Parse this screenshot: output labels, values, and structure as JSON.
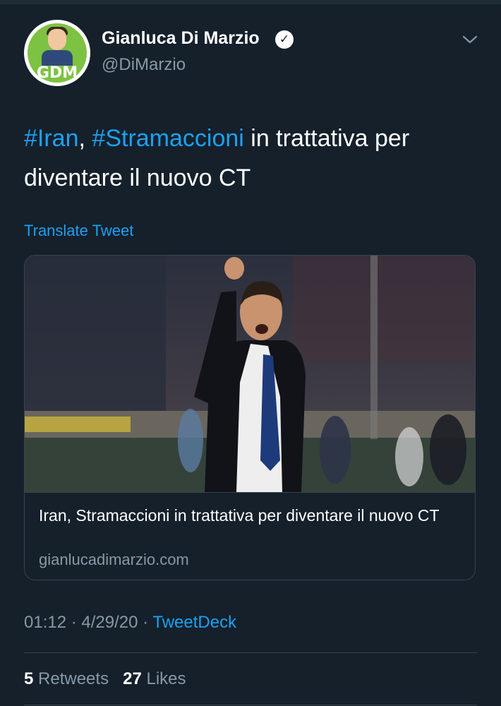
{
  "author": {
    "display_name": "Gianluca Di Marzio",
    "handle": "@DiMarzio",
    "avatar_text": "GDM",
    "verified": true
  },
  "tweet": {
    "hashtag_1": "#Iran",
    "separator": ", ",
    "hashtag_2": "#Stramaccioni",
    "text_rest": " in trattativa per diventare il nuovo CT",
    "translate_label": "Translate Tweet"
  },
  "link_card": {
    "title": "Iran, Stramaccioni in trattativa per diventare il nuovo CT",
    "domain": "gianlucadimarzio.com"
  },
  "meta": {
    "time": "01:12",
    "sep1": " · ",
    "date": "4/29/20",
    "sep2": " · ",
    "source": "TweetDeck"
  },
  "stats": {
    "retweets_count": "5",
    "retweets_label": "Retweets",
    "likes_count": "27",
    "likes_label": "Likes"
  },
  "colors": {
    "background": "#15202b",
    "accent": "#1da1f2",
    "secondary_text": "#8899a6",
    "border": "#38444d"
  }
}
